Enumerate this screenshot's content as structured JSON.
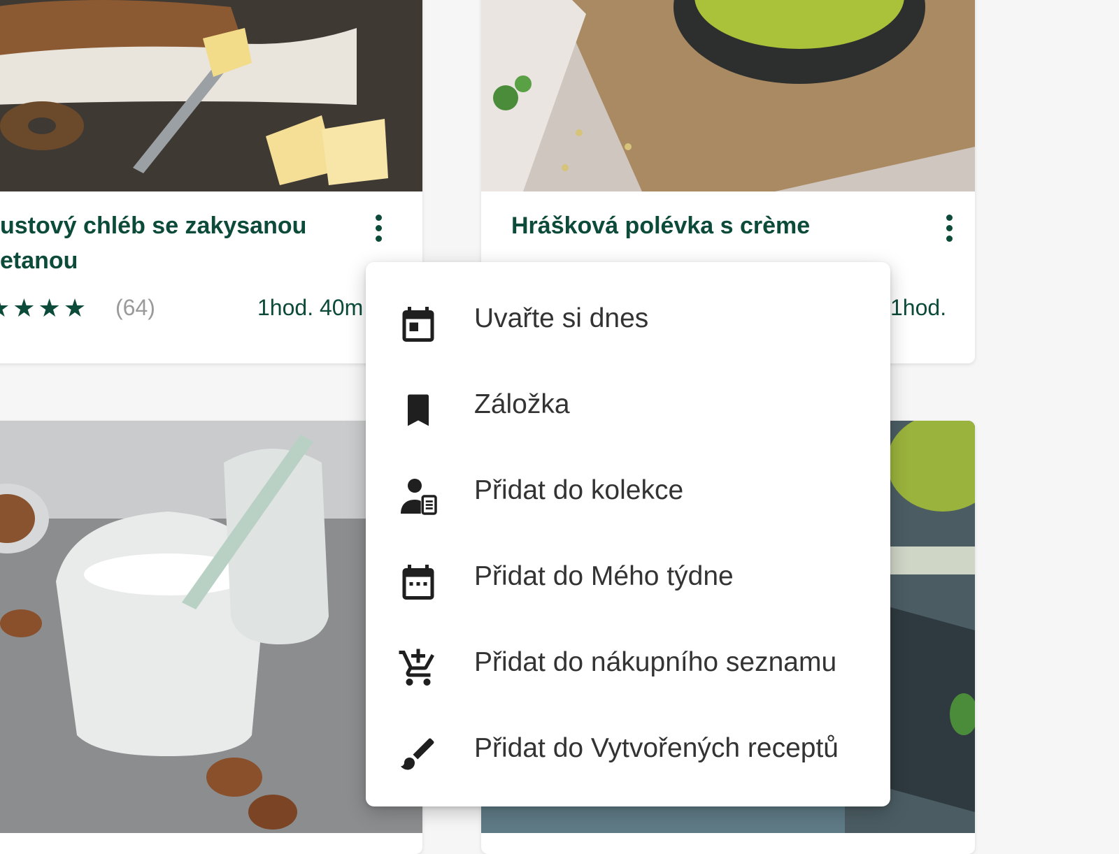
{
  "cards": [
    {
      "title_line1": "ustový chléb se zakysanou",
      "title_line2": "etanou",
      "stars": "★★★★",
      "rating_count": "(64)",
      "time": "1hod. 40m"
    },
    {
      "title_line1": "Hrášková polévka s crème",
      "time": "1hod."
    }
  ],
  "menu": {
    "items": [
      {
        "label": "Uvařte si dnes",
        "icon": "calendar-today-icon"
      },
      {
        "label": "Záložka",
        "icon": "bookmark-icon"
      },
      {
        "label": "Přidat do kolekce",
        "icon": "collection-icon"
      },
      {
        "label": "Přidat do Mého týdne",
        "icon": "calendar-week-icon"
      },
      {
        "label": "Přidat do nákupního seznamu",
        "icon": "cart-add-icon"
      },
      {
        "label": "Přidat do Vytvořených receptů",
        "icon": "brush-icon"
      }
    ]
  },
  "colors": {
    "title": "#0c4a3a",
    "menu_text": "#333333"
  }
}
